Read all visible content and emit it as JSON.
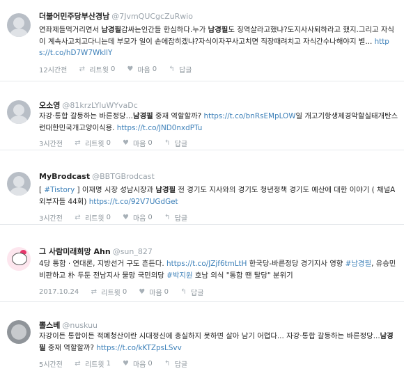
{
  "tweets": [
    {
      "name": "더불어민주당부산경남",
      "handle": "@7JvmQUCgcZuRwio",
      "segments": [
        {
          "t": "연좌제들먹거리면서 "
        },
        {
          "t": "남경필",
          "k": "kw"
        },
        {
          "t": "감싸는인간들 한심하다.누가 "
        },
        {
          "t": "남경필",
          "k": "kw"
        },
        {
          "t": "도 징역살라고했냐?도지사사퇴하라고 했지.그리고 자식이 계속사고치고다니는데 부모가 일이 손에잡히겠냐?자식이자꾸사고치면 직장때려치고 자식간수나해야지 별... "
        },
        {
          "t": "https://t.co/hD7W7WkllY",
          "k": "lnk"
        }
      ],
      "time": "12시간전",
      "retweet_label": "리트윗",
      "retweet_count": "0",
      "like_label": "마음",
      "like_count": "0",
      "reply_label": "답글"
    },
    {
      "name": "오소영",
      "handle": "@81krzLYluWYvaDc",
      "segments": [
        {
          "t": "자강·통합 갈등하는 바른정당…"
        },
        {
          "t": "남경필",
          "k": "kw"
        },
        {
          "t": " 중재 역할할까? "
        },
        {
          "t": "https://t.co/bnRsEMpLOW",
          "k": "lnk"
        },
        {
          "t": "일 개고기항생제경악할실태개탄스런대한민국개고양이식용. "
        },
        {
          "t": "https://t.co/JND0nxdPTu",
          "k": "lnk"
        }
      ],
      "time": "3시간전",
      "retweet_label": "리트윗",
      "retweet_count": "0",
      "like_label": "마음",
      "like_count": "0",
      "reply_label": "답글"
    },
    {
      "name": "MyBrodcast",
      "handle": "@BBTGBrodcast",
      "segments": [
        {
          "t": "[ "
        },
        {
          "t": "#Tistory",
          "k": "lnk"
        },
        {
          "t": " ] 이재명 시장 성남시장과 "
        },
        {
          "t": "남경필",
          "k": "kw"
        },
        {
          "t": " 전 경기도 지사와의 경기도 청년정책 경기도 예산에 대한 이야기 ( 채널A 외부자들 44회) "
        },
        {
          "t": "https://t.co/92V7UGdGet",
          "k": "lnk"
        }
      ],
      "time": "3시간전",
      "retweet_label": "리트윗",
      "retweet_count": "0",
      "like_label": "마음",
      "like_count": "0",
      "reply_label": "답글"
    },
    {
      "name": "그 사람미래희망 Ahn",
      "handle": "@sun_827",
      "segments": [
        {
          "t": "4당 통합 · 연대론, 지방선거 구도 흔든다. "
        },
        {
          "t": "https://t.co/JZjf6tmLtH",
          "k": "lnk"
        },
        {
          "t": " 한국당-바른정당 경기지사 영향 "
        },
        {
          "t": "#남경필",
          "k": "lnk"
        },
        {
          "t": ", 유승민 비판하고 朴 두둔 전남지사 물망 국민의당 "
        },
        {
          "t": "#박지원",
          "k": "lnk"
        },
        {
          "t": " 호남 의식 \"통합 땐 탈당\" 분위기"
        }
      ],
      "time": "2017.10.24",
      "retweet_label": "리트윗",
      "retweet_count": "0",
      "like_label": "마음",
      "like_count": "0",
      "reply_label": "답글"
    },
    {
      "name": "뽈스베",
      "handle": "@nuskuu",
      "segments": [
        {
          "t": "자강이든 통합이든 적폐청산이란 시대정신에 충실하지 못하면 살아 남기 어렵다... 자강·통합 갈등하는 바른정당..."
        },
        {
          "t": "남경필",
          "k": "kw"
        },
        {
          "t": " 중재 역할할까? "
        },
        {
          "t": "https://t.co/kKTZpsLSvv",
          "k": "lnk"
        }
      ],
      "time": "5시간전",
      "retweet_label": "리트윗",
      "retweet_count": "1",
      "like_label": "마음",
      "like_count": "0",
      "reply_label": "답글"
    }
  ]
}
